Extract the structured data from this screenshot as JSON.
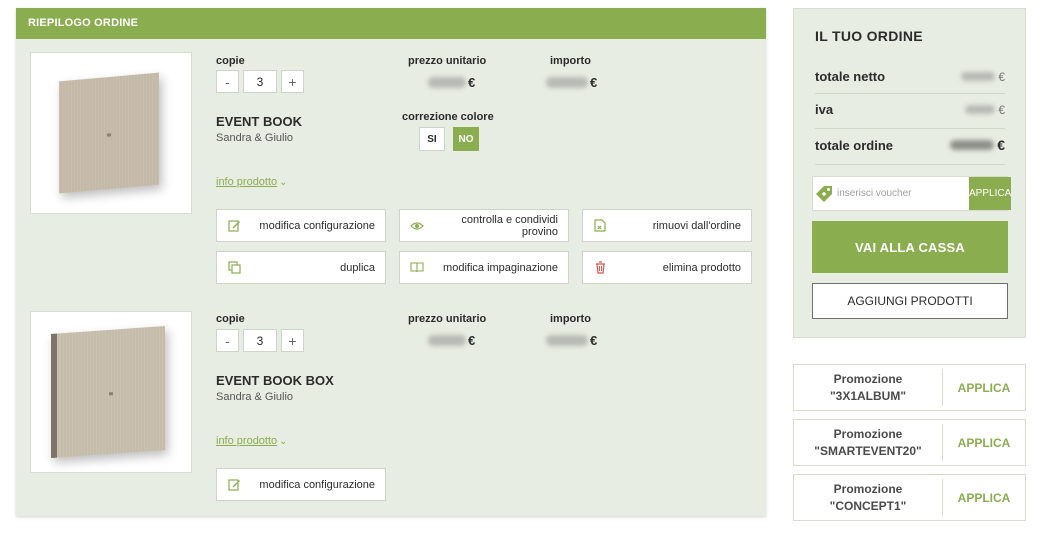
{
  "summary": {
    "header": "RIEPILOGO ORDINE"
  },
  "labels": {
    "copies": "copie",
    "unit_price": "prezzo unitario",
    "amount": "importo",
    "color_correction": "correzione colore",
    "info": "info prodotto",
    "currency": "€"
  },
  "products": [
    {
      "name": "EVENT BOOK",
      "subtitle": "Sandra & Giulio",
      "quantity": "3",
      "color_correction": {
        "yes": "SI",
        "no": "NO",
        "selected": "NO"
      },
      "actions": [
        {
          "label": "modifica configurazione",
          "icon": "edit-icon"
        },
        {
          "label": "controlla e condividi provino",
          "icon": "eye-icon"
        },
        {
          "label": "rimuovi dall'ordine",
          "icon": "remove-doc-icon"
        },
        {
          "label": "duplica",
          "icon": "duplicate-icon"
        },
        {
          "label": "modifica impaginazione",
          "icon": "book-open-icon"
        },
        {
          "label": "elimina prodotto",
          "icon": "trash-icon"
        }
      ]
    },
    {
      "name": "EVENT BOOK BOX",
      "subtitle": "Sandra & Giulio",
      "quantity": "3",
      "actions": [
        {
          "label": "modifica configurazione",
          "icon": "edit-icon"
        }
      ]
    }
  ],
  "order": {
    "title": "IL TUO ORDINE",
    "net_total_label": "totale netto",
    "vat_label": "iva",
    "order_total_label": "totale ordine",
    "voucher_placeholder": "inserisci voucher",
    "voucher_apply": "APPLICA",
    "checkout": "VAI ALLA CASSA",
    "add_products": "AGGIUNGI PRODOTTI"
  },
  "promotions": [
    {
      "label": "Promozione",
      "code": "\"3X1ALBUM\"",
      "action": "APPLICA"
    },
    {
      "label": "Promozione",
      "code": "\"SMARTEVENT20\"",
      "action": "APPLICA"
    },
    {
      "label": "Promozione",
      "code": "\"CONCEPT1\"",
      "action": "APPLICA"
    }
  ],
  "colors": {
    "accent": "#8aad4f",
    "panel": "#e8ede3",
    "danger": "#d9534f"
  }
}
